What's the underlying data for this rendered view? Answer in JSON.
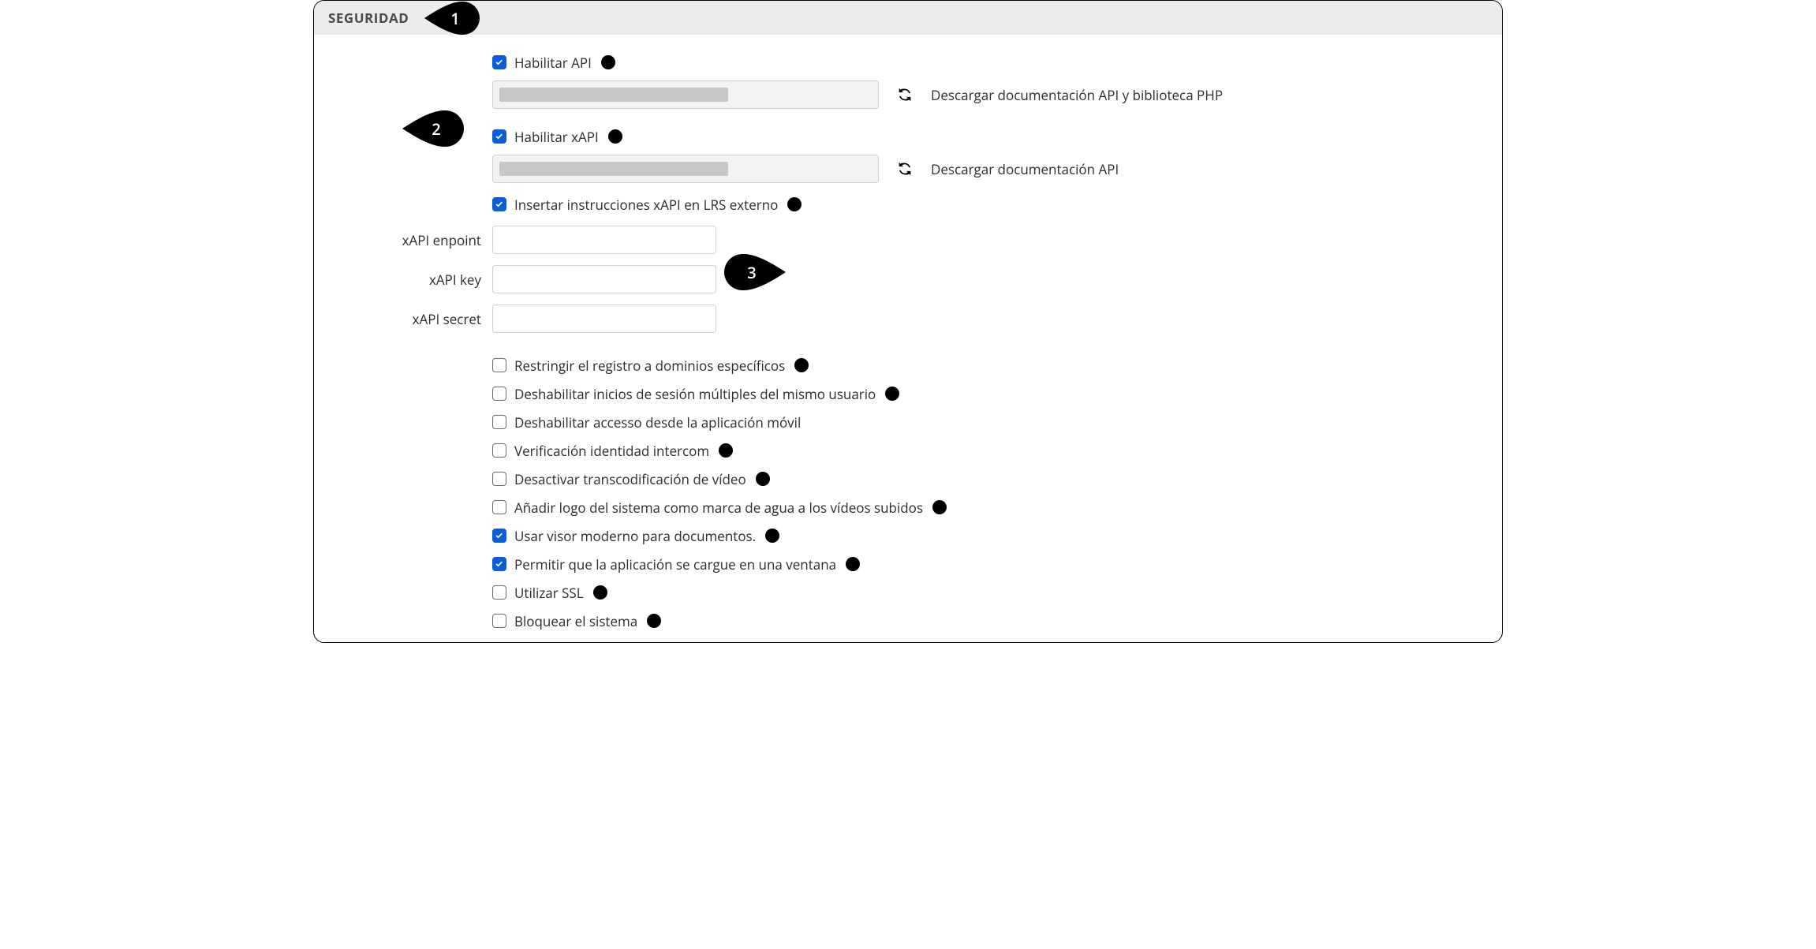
{
  "section_title": "SEGURIDAD",
  "callouts": {
    "c1": "1",
    "c2": "2",
    "c3": "3"
  },
  "api": {
    "enable_label": "Habilitar API",
    "download_label": "Descargar documentación API y biblioteca PHP"
  },
  "xapi": {
    "enable_label": "Habilitar xAPI",
    "download_label": "Descargar documentación API",
    "push_lrs_label": "Insertar instrucciones xAPI en LRS externo",
    "endpoint_label": "xAPI enpoint",
    "key_label": "xAPI key",
    "secret_label": "xAPI secret",
    "endpoint_value": "",
    "key_value": "",
    "secret_value": ""
  },
  "options": {
    "restrict_domains": "Restringir el registro a dominios específicos",
    "disable_multi_login": "Deshabilitar inicios de sesión múltiples del mismo usuario",
    "disable_mobile": "Deshabilitar accesso desde la aplicación móvil",
    "intercom_verify": "Verificación identidad intercom",
    "disable_transcode": "Desactivar transcodificación de vídeo",
    "watermark": "Añadir logo del sistema como marca de agua a los vídeos subidos",
    "modern_viewer": "Usar visor moderno para documentos.",
    "iframe_window": "Permitir que la aplicación se cargue en una ventana",
    "use_ssl": "Utilizar SSL",
    "lock_system": "Bloquear el sistema"
  }
}
